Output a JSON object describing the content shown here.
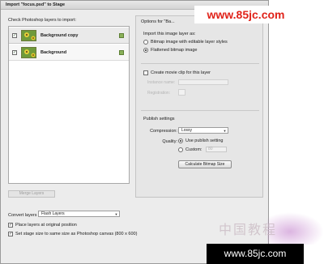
{
  "window": {
    "title": "Import \"focus.psd\" to Stage"
  },
  "layers": {
    "caption": "Check Photoshop layers to import:",
    "items": [
      {
        "label": "Background copy",
        "checked": true
      },
      {
        "label": "Background",
        "checked": true
      }
    ],
    "merge_button": "Merge Layers"
  },
  "options": {
    "title": "Options for \"Ba...",
    "import_heading": "Import this image layer as:",
    "import_choices": [
      {
        "label": "Bitmap image with editable layer styles",
        "selected": false
      },
      {
        "label": "Flattened bitmap image",
        "selected": true
      }
    ],
    "movie_clip_label": "Create movie clip for this layer",
    "instance_name_label": "Instance name:",
    "registration_label": "Registration:",
    "publish_heading": "Publish settings",
    "compression_label": "Compression:",
    "compression_value": "Lossy",
    "quality_label": "Quality:",
    "quality_choices": [
      {
        "label": "Use publish setting",
        "selected": true
      },
      {
        "label": "Custom:",
        "selected": false
      }
    ],
    "custom_value": "80",
    "calc_button": "Calculate Bitmap Size"
  },
  "bottom": {
    "convert_label": "Convert layers to:",
    "convert_value": "Flash Layers",
    "place_label": "Place layers at original position",
    "stage_label": "Set stage size to same size as Photoshop canvas (800 x 600)"
  },
  "watermarks": {
    "top": "www.85jc.com",
    "bottom": "www.85jc.com",
    "cn": "中国教程"
  },
  "colors": {
    "watermark_red": "#e0231a",
    "thumb_green": "#6f9a3a"
  }
}
